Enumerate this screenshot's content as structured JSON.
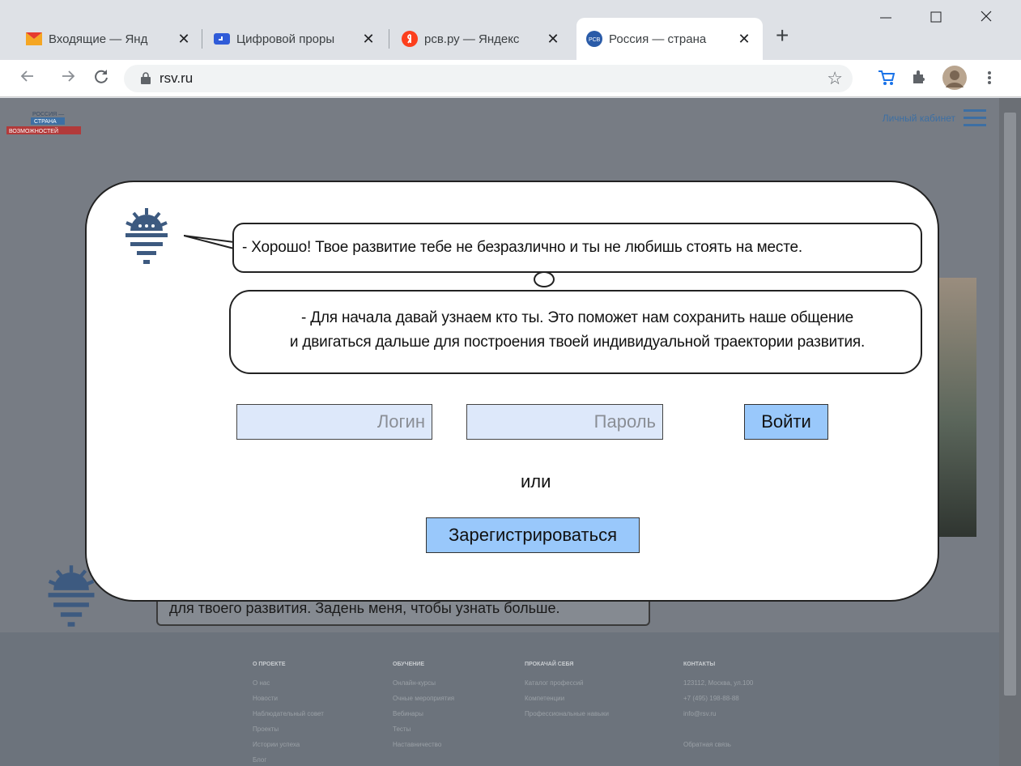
{
  "browser": {
    "tabs": [
      {
        "title": "Входящие — Янд",
        "icon": "yandex-mail-icon"
      },
      {
        "title": "Цифровой проры",
        "icon": "digital-breakthrough-icon"
      },
      {
        "title": "рсв.ру — Яндекс",
        "icon": "yandex-icon"
      },
      {
        "title": "Россия — страна",
        "icon": "rsv-icon",
        "active": true
      }
    ],
    "close_glyph": "✕",
    "new_tab_glyph": "+",
    "url": "rsv.ru"
  },
  "site": {
    "account_link": "Личный кабинет",
    "logo_text": [
      "РОССИЯ —",
      "СТРАНА",
      "ВОЗМОЖНОСТЕЙ"
    ],
    "background_bubble_text": "для твоего развития. Задень меня, чтобы узнать больше.",
    "footer": {
      "columns": [
        {
          "heading": "О ПРОЕКТЕ",
          "items": [
            "О нас",
            "Новости",
            "Наблюдательный совет",
            "Проекты",
            "Истории успеха",
            "Блог"
          ]
        },
        {
          "heading": "ОБУЧЕНИЕ",
          "items": [
            "Онлайн-курсы",
            "Очные мероприятия",
            "Вебинары",
            "Тесты",
            "Наставничество"
          ]
        },
        {
          "heading": "ПРОКАЧАЙ СЕБЯ",
          "items": [
            "Каталог профессий",
            "Компетенции",
            "Профессиональные навыки"
          ]
        },
        {
          "heading": "КОНТАКТЫ",
          "items": [
            "123112, Москва, ул.100",
            "+7 (495) 198-88-88",
            "info@rsv.ru",
            "",
            "Обратная связь"
          ]
        }
      ]
    }
  },
  "modal": {
    "message1": "-  Хорошо! Твое развитие тебе не безразлично и ты не любишь стоять на месте.",
    "message2_line1": "-  Для начала давай узнаем кто ты. Это поможет нам сохранить наше общение",
    "message2_line2": "и двигаться дальше для построения твоей индивидуальной траектории развития.",
    "login_placeholder": "Логин",
    "password_placeholder": "Пароль",
    "login_button": "Войти",
    "or_text": "или",
    "register_button": "Зарегистрироваться"
  },
  "colors": {
    "accent_button": "#99c8fb",
    "input_bg": "#dde8fa",
    "brand_blue": "#3d6fa3",
    "overlay": "#777c84"
  }
}
